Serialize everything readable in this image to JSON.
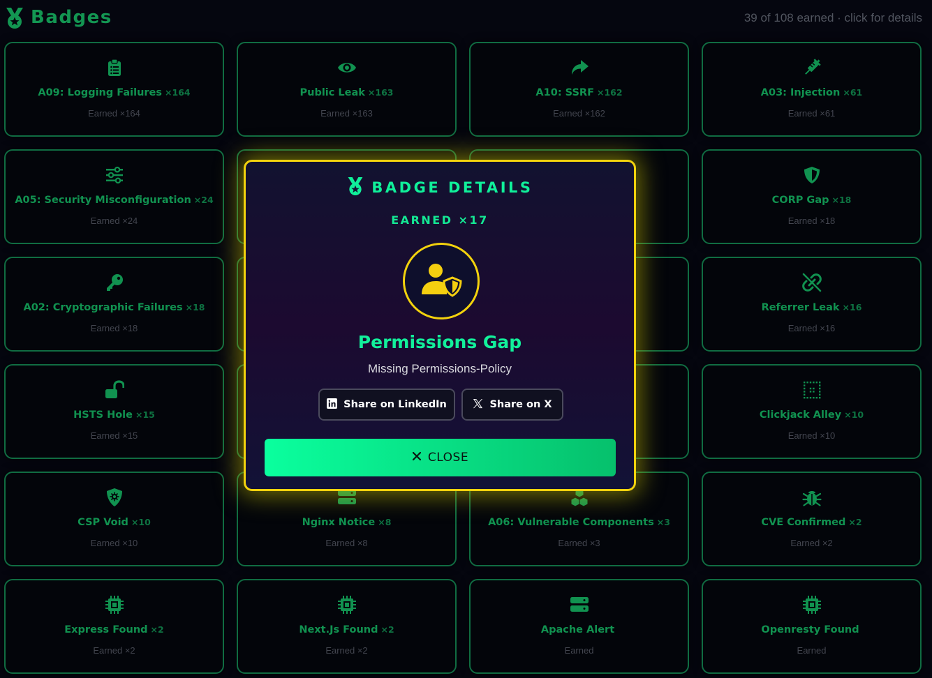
{
  "header": {
    "title": "Badges",
    "summary": "39 of 108 earned · click for details",
    "logo_icon": "medal-icon"
  },
  "colors": {
    "accent": "#13a35a",
    "modal_border": "#f2d20d",
    "modal_title": "#10f09a",
    "close_button": "#0aff9e"
  },
  "badges": [
    {
      "name": "A09: Logging Failures",
      "count": "×164",
      "earned": "Earned ×164",
      "icon": "clipboard-list-icon"
    },
    {
      "name": "Public Leak",
      "count": "×163",
      "earned": "Earned ×163",
      "icon": "eye-icon"
    },
    {
      "name": "A10: SSRF",
      "count": "×162",
      "earned": "Earned ×162",
      "icon": "share-arrow-icon"
    },
    {
      "name": "A03: Injection",
      "count": "×61",
      "earned": "Earned ×61",
      "icon": "syringe-icon"
    },
    {
      "name": "A05: Security Misconfiguration",
      "count": "×24",
      "earned": "Earned ×24",
      "icon": "sliders-icon"
    },
    {
      "name": "",
      "count": "",
      "earned": "",
      "icon": ""
    },
    {
      "name": "",
      "count": "",
      "earned": "",
      "icon": ""
    },
    {
      "name": "CORP Gap",
      "count": "×18",
      "earned": "Earned ×18",
      "icon": "shield-half-icon"
    },
    {
      "name": "A02: Cryptographic Failures",
      "count": "×18",
      "earned": "Earned ×18",
      "icon": "key-icon"
    },
    {
      "name": "",
      "count": "",
      "earned": "",
      "icon": ""
    },
    {
      "name": "",
      "count": "",
      "earned": "",
      "icon": ""
    },
    {
      "name": "Referrer Leak",
      "count": "×16",
      "earned": "Earned ×16",
      "icon": "broken-link-icon"
    },
    {
      "name": "HSTS Hole",
      "count": "×15",
      "earned": "Earned ×15",
      "icon": "unlock-icon"
    },
    {
      "name": "",
      "count": "",
      "earned": "",
      "icon": ""
    },
    {
      "name": "",
      "count": "",
      "earned": "",
      "icon": ""
    },
    {
      "name": "Clickjack Alley",
      "count": "×10",
      "earned": "Earned ×10",
      "icon": "dotted-grid-icon"
    },
    {
      "name": "CSP Void",
      "count": "×10",
      "earned": "Earned ×10",
      "icon": "shield-virus-icon"
    },
    {
      "name": "Nginx Notice",
      "count": "×8",
      "earned": "Earned ×8",
      "icon": "server-icon"
    },
    {
      "name": "A06: Vulnerable Components",
      "count": "×3",
      "earned": "Earned ×3",
      "icon": "cubes-icon"
    },
    {
      "name": "CVE Confirmed",
      "count": "×2",
      "earned": "Earned ×2",
      "icon": "bug-icon"
    },
    {
      "name": "Express Found",
      "count": "×2",
      "earned": "Earned ×2",
      "icon": "microchip-icon"
    },
    {
      "name": "Next.Js Found",
      "count": "×2",
      "earned": "Earned ×2",
      "icon": "microchip-icon"
    },
    {
      "name": "Apache Alert",
      "count": "",
      "earned": "Earned",
      "icon": "server-icon"
    },
    {
      "name": "Openresty Found",
      "count": "",
      "earned": "Earned",
      "icon": "microchip-icon"
    }
  ],
  "modal": {
    "title": "BADGE DETAILS",
    "earned": "EARNED ×17",
    "badge_name": "Permissions Gap",
    "description": "Missing Permissions-Policy",
    "badge_icon": "user-shield-icon",
    "share_linkedin": "Share on LinkedIn",
    "share_x": "Share on X",
    "close_label": "CLOSE"
  }
}
